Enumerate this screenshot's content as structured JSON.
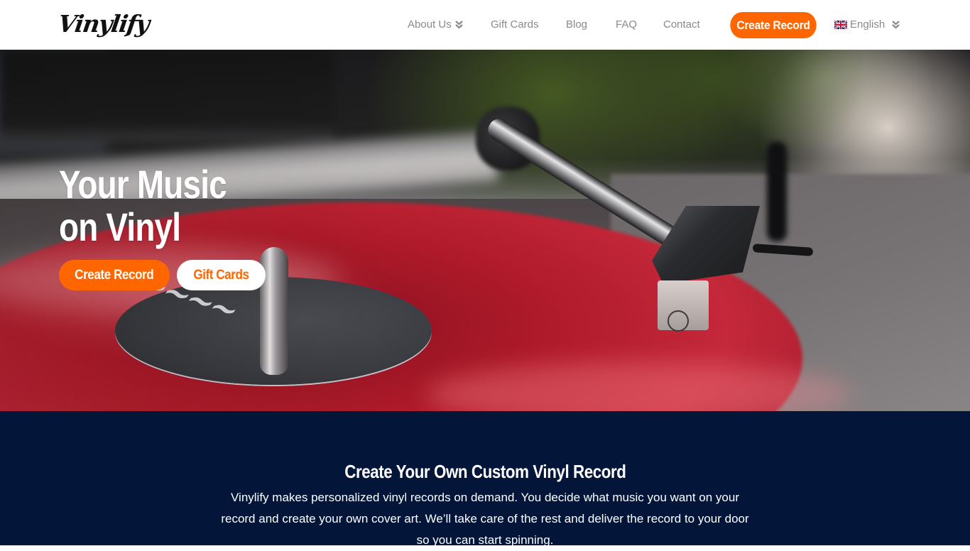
{
  "header": {
    "logo_text": "Vinylify",
    "nav": [
      {
        "label": "About Us",
        "has_dropdown": true
      },
      {
        "label": "Gift Cards",
        "has_dropdown": false
      },
      {
        "label": "Blog",
        "has_dropdown": false
      },
      {
        "label": "FAQ",
        "has_dropdown": false
      },
      {
        "label": "Contact",
        "has_dropdown": false
      }
    ],
    "cta_label": "Create Record",
    "language": {
      "label": "English",
      "flag": "uk-flag-icon"
    }
  },
  "hero": {
    "title_line1": "Your Music",
    "title_line2": "on Vinyl",
    "primary_button": "Create Record",
    "secondary_button": "Gift Cards",
    "image_description": "Red vinyl record spinning on a turntable with tonearm"
  },
  "intro": {
    "title": "Create Your Own Custom Vinyl Record",
    "text": "Vinylify makes personalized vinyl records on demand. You decide what music you want on your record and create your own cover art. We’ll take care of the rest and deliver the record to your door so you can start spinning."
  },
  "colors": {
    "accent": "#ff6600",
    "nav_text": "#8a8a8a",
    "intro_bg": "#03163a",
    "white": "#ffffff"
  }
}
